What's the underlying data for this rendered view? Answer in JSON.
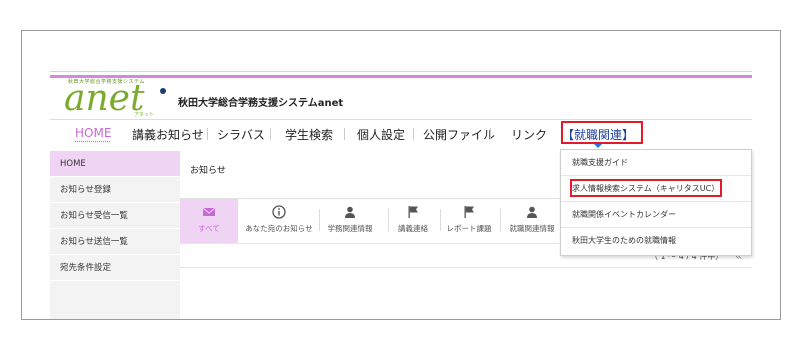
{
  "logo": {
    "tagline": "秋田大学総合学務支援システム",
    "wordmark": "anet",
    "kana": "アネット",
    "brand_color": "#7bab2e"
  },
  "header": {
    "system_title": "秋田大学総合学務支援システムanet"
  },
  "nav": {
    "home": "HOME",
    "notices": "講義お知らせ",
    "syllabus": "シラバス",
    "student_search": "学生検索",
    "personal_settings": "個人設定",
    "public_files": "公開ファイル",
    "links": "リンク",
    "job_related": "【就職関連】"
  },
  "sidebar": {
    "items": [
      {
        "label": "HOME"
      },
      {
        "label": "お知らせ登録"
      },
      {
        "label": "お知らせ受信一覧"
      },
      {
        "label": "お知らせ送信一覧"
      },
      {
        "label": "宛先条件設定"
      }
    ]
  },
  "content": {
    "title": "お知らせ",
    "categories": [
      {
        "label": "すべて",
        "icon": "envelope-icon"
      },
      {
        "label": "あなた宛のお知らせ",
        "icon": "info-icon"
      },
      {
        "label": "学務関連情報",
        "icon": "person-icon"
      },
      {
        "label": "講義連絡",
        "icon": "flag-icon"
      },
      {
        "label": "レポート課題",
        "icon": "flag-icon"
      },
      {
        "label": "就職関連情報",
        "icon": "person-icon"
      }
    ],
    "pager": "（ 1 ～ 4 / 4 件中）",
    "pager_arrow": "«"
  },
  "dropdown": {
    "items": [
      {
        "label": "就職支援ガイド"
      },
      {
        "label": "求人情報検索システム（キャリタスUC）"
      },
      {
        "label": "就職関係イベントカレンダー"
      },
      {
        "label": "秋田大学生のための就職情報"
      }
    ]
  },
  "colors": {
    "accent": "#c76ad8",
    "highlight_box": "#e21a2a",
    "job_link": "#1a3fa0"
  }
}
